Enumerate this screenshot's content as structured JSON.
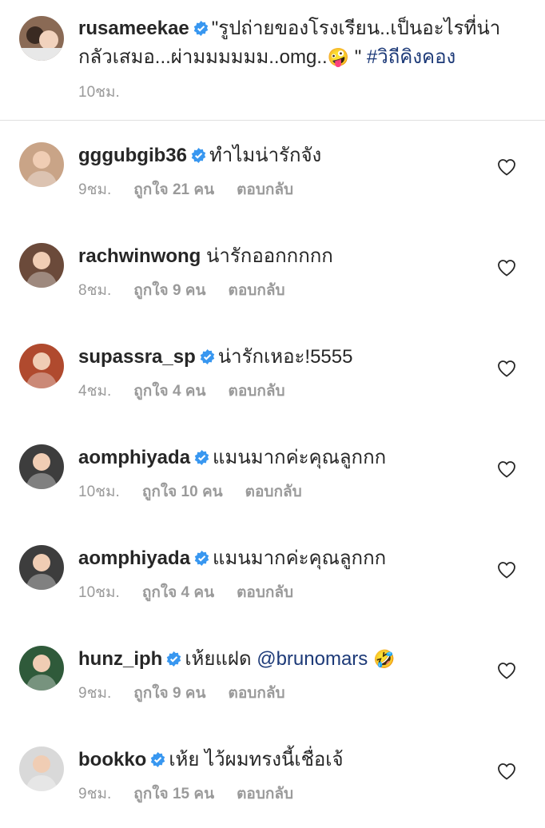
{
  "caption": {
    "username": "rusameekae",
    "text": "\"รูปถ่ายของโรงเรียน..เป็นอะไรที่น่ากลัวเสมอ...ผ่ามมมมมม..omg..",
    "emoji": "🤪",
    "text_end": "\"",
    "hashtag": "#วิถีคิงคอง",
    "time": "10ชม."
  },
  "comments": [
    {
      "username": "gggubgib36",
      "verified": true,
      "text": "ทำไมน่ารักจัง",
      "time": "9ชม.",
      "likes": "ถูกใจ 21 คน",
      "reply": "ตอบกลับ",
      "avatar_color": "#c9a487"
    },
    {
      "username": "rachwinwong",
      "verified": false,
      "text": "น่ารักออกกกกก",
      "time": "8ชม.",
      "likes": "ถูกใจ 9 คน",
      "reply": "ตอบกลับ",
      "avatar_color": "#6b4a3a"
    },
    {
      "username": "supassra_sp",
      "verified": true,
      "text": "น่ารักเหอะ!5555",
      "time": "4ชม.",
      "likes": "ถูกใจ 4 คน",
      "reply": "ตอบกลับ",
      "avatar_color": "#b04a2e"
    },
    {
      "username": "aomphiyada",
      "verified": true,
      "text": "แมนมากค่ะคุณลูกกก",
      "time": "10ชม.",
      "likes": "ถูกใจ 10 คน",
      "reply": "ตอบกลับ",
      "avatar_color": "#3d3d3d"
    },
    {
      "username": "aomphiyada",
      "verified": true,
      "text": "แมนมากค่ะคุณลูกกก",
      "time": "10ชม.",
      "likes": "ถูกใจ 4 คน",
      "reply": "ตอบกลับ",
      "avatar_color": "#3d3d3d"
    },
    {
      "username": "hunz_iph",
      "verified": true,
      "text": "เห้ยแฝด",
      "mention": "@brunomars",
      "emoji": "🤣",
      "time": "9ชม.",
      "likes": "ถูกใจ 9 คน",
      "reply": "ตอบกลับ",
      "avatar_color": "#2f5a3a"
    },
    {
      "username": "bookko",
      "verified": true,
      "text": "เห้ย ไว้ผมทรงนี้เชื่อเจ้",
      "time": "9ชม.",
      "likes": "ถูกใจ 15 คน",
      "reply": "ตอบกลับ",
      "avatar_color": "#d9d9d9"
    }
  ],
  "colors": {
    "verified": "#3897f0",
    "link": "#1d3a78",
    "meta": "#9a9a9a"
  }
}
